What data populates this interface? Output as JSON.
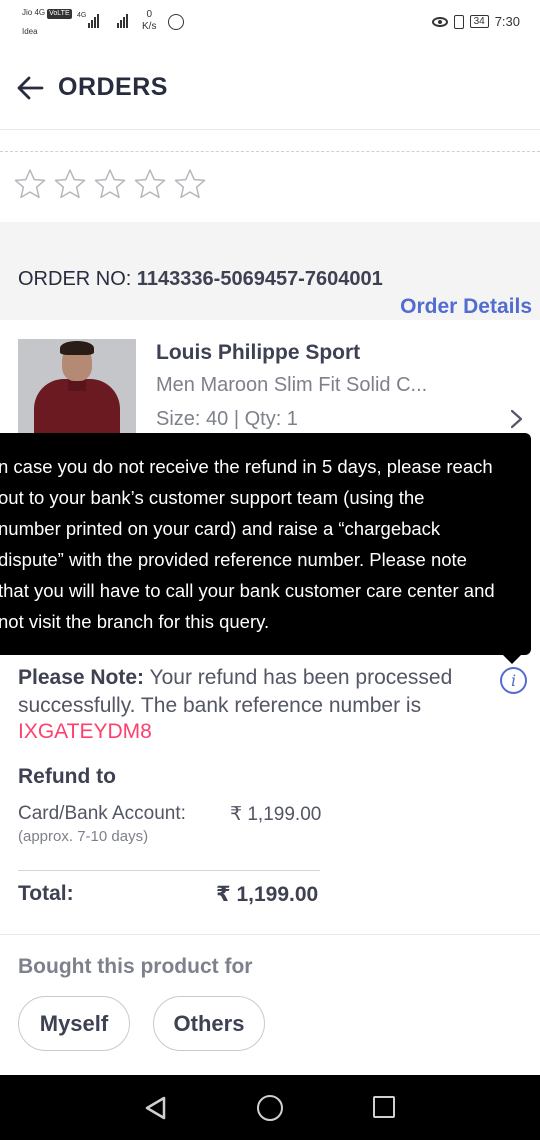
{
  "status_bar": {
    "carrier1": "Jio 4G",
    "volte": "VoLTE",
    "carrier2": "Idea",
    "net_type": "4G",
    "speed_value": "0",
    "speed_unit": "K/s",
    "battery": "34",
    "time": "7:30"
  },
  "header": {
    "title": "ORDERS"
  },
  "rating": {
    "stars": 5,
    "filled": 0
  },
  "order": {
    "number_label": "ORDER NO: ",
    "number_value": "1143336-5069457-7604001",
    "details_link": "Order Details"
  },
  "product": {
    "brand": "Louis Philippe Sport",
    "name": "Men Maroon Slim Fit Solid C...",
    "size_qty": "Size: 40 | Qty: 1"
  },
  "tooltip": {
    "text": "n case you do not receive the refund in 5 days, please reach\nout to your bank’s customer support team (using the\nnumber printed on your card) and raise a “chargeback\ndispute” with the provided reference number. Please note\nthat you will have to call your bank customer care center and\nnot visit the branch for this query."
  },
  "refund": {
    "note_label": "Please Note:",
    "note_text": " Your refund has been processed successfully. The bank reference number is",
    "reference": "IXGATEYDM8",
    "refund_to_title": "Refund to",
    "card_label": "Card/Bank Account:",
    "card_sub": "(approx. 7-10 days)",
    "card_amount": "₹ 1,199.00",
    "total_label": "Total:",
    "total_amount": "₹ 1,199.00"
  },
  "bought_for": {
    "title": "Bought this product for",
    "options": [
      "Myself",
      "Others"
    ]
  },
  "colors": {
    "accent_blue": "#526cd0",
    "reference_pink": "#ff3f6c",
    "tooltip_bg": "#000000"
  }
}
